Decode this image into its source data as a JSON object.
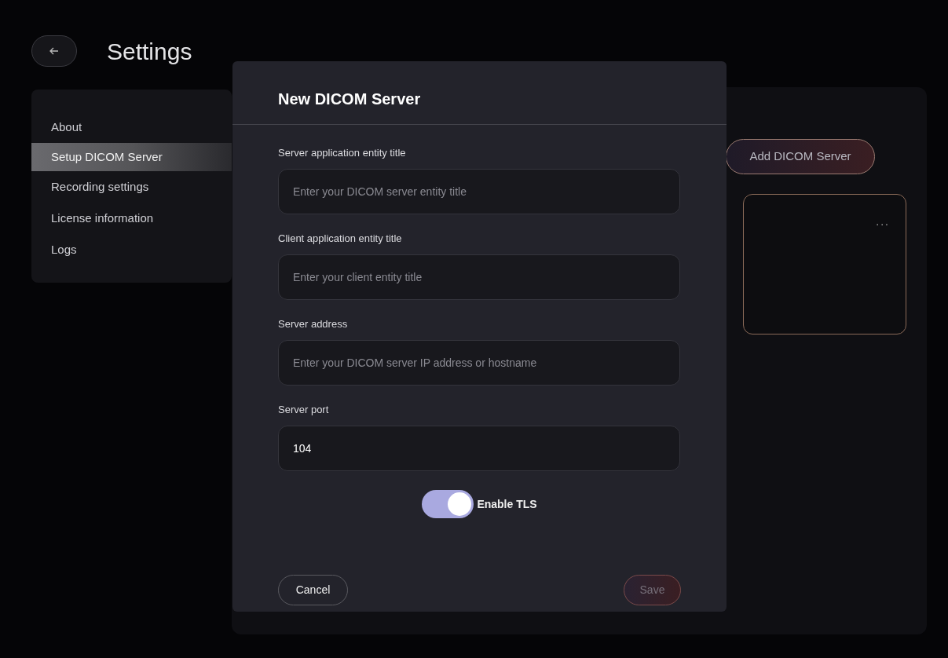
{
  "header": {
    "title": "Settings"
  },
  "sidebar": {
    "items": [
      {
        "label": "About",
        "selected": false
      },
      {
        "label": "Setup DICOM Server",
        "selected": true
      },
      {
        "label": "Recording settings",
        "selected": false
      },
      {
        "label": "License information",
        "selected": false
      },
      {
        "label": "Logs",
        "selected": false
      }
    ]
  },
  "content": {
    "add_button": "Add DICOM Server",
    "card": {
      "menu": "..."
    }
  },
  "dialog": {
    "title": "New DICOM Server",
    "fields": [
      {
        "label": "Server application entity title",
        "placeholder": "Enter your DICOM server entity title"
      },
      {
        "label": "Client application entity title",
        "placeholder": "Enter your client entity title"
      },
      {
        "label": "Server address",
        "placeholder": "Enter your DICOM server IP address or hostname"
      },
      {
        "label": "Server port",
        "value": "104"
      }
    ],
    "toggle": {
      "label": "Enable TLS",
      "on": true
    },
    "cancel": {
      "label": "Cancel",
      "disabled": false
    },
    "save": {
      "label": "Save",
      "disabled": true
    }
  }
}
